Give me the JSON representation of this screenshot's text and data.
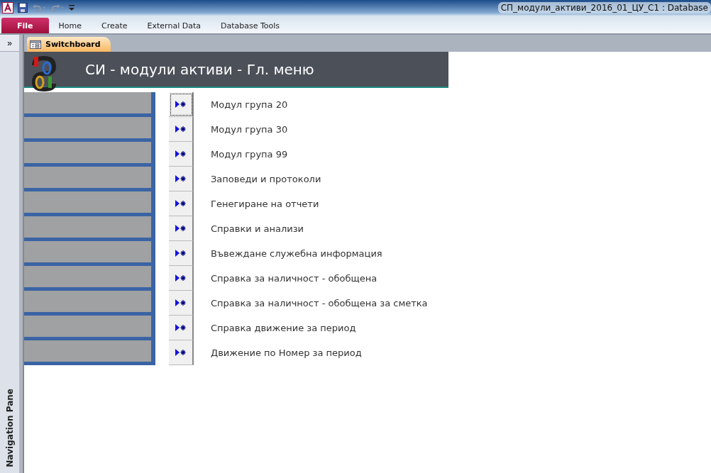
{
  "window": {
    "title": "СП_модули_активи_2016_01_ЦУ_С1 : Database"
  },
  "ribbon_tabs": [
    {
      "label": "File",
      "selected": true
    },
    {
      "label": "Home",
      "selected": false
    },
    {
      "label": "Create",
      "selected": false
    },
    {
      "label": "External Data",
      "selected": false
    },
    {
      "label": "Database Tools",
      "selected": false
    }
  ],
  "navigation_pane": {
    "label": "Navigation Pane",
    "expand_button": "»"
  },
  "document_tab": {
    "label": "Switchboard"
  },
  "form": {
    "title": "СИ - модули активи - Гл. меню",
    "items": [
      {
        "label": "Модул група 20",
        "focused": true
      },
      {
        "label": "Модул група 30",
        "focused": false
      },
      {
        "label": "Модул група 99",
        "focused": false
      },
      {
        "label": "Заповеди и протоколи",
        "focused": false
      },
      {
        "label": "Генегиране на отчети",
        "focused": false
      },
      {
        "label": "Справки и анализи",
        "focused": false
      },
      {
        "label": "Въвеждане служебна информация",
        "focused": false
      },
      {
        "label": "Справка за наличност - обобщена",
        "focused": false
      },
      {
        "label": "Справка за наличност - обобщена за сметка",
        "focused": false
      },
      {
        "label": "Справка движение за период",
        "focused": false
      },
      {
        "label": "Движение по Номер за период",
        "focused": false
      }
    ]
  }
}
